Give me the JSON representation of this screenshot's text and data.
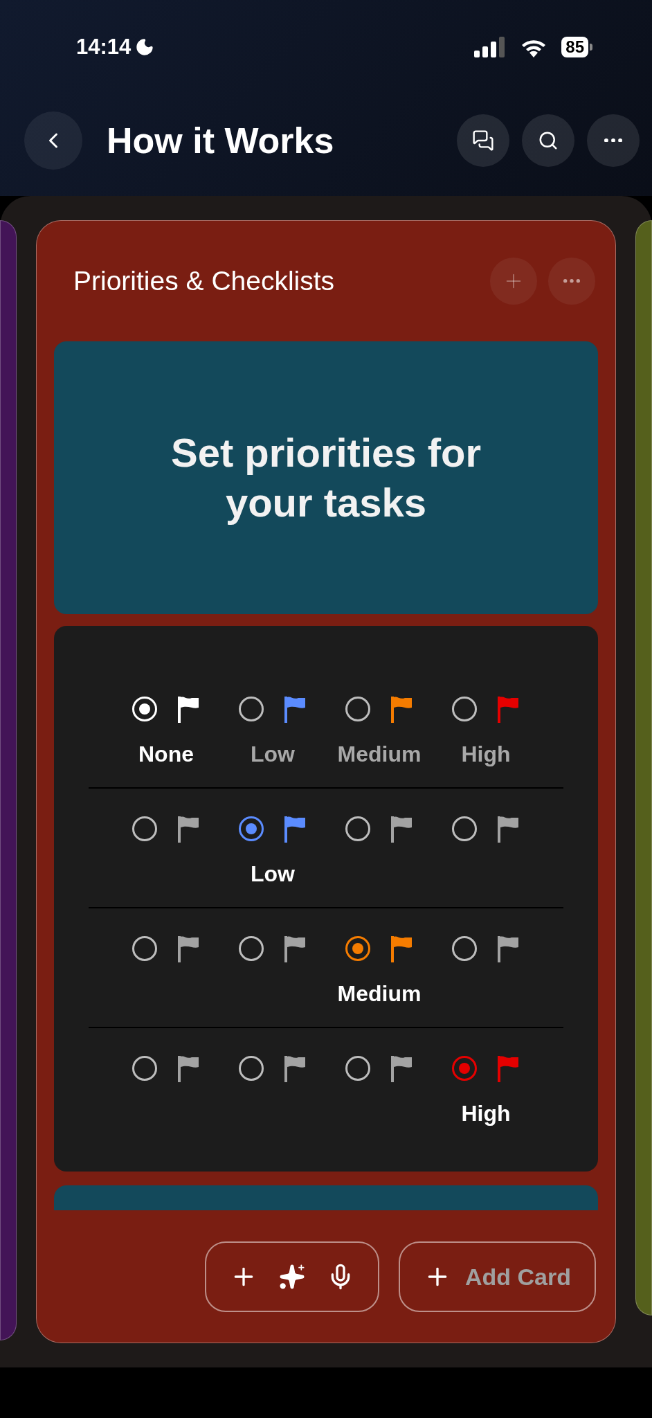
{
  "status_bar": {
    "time": "14:14",
    "battery": "85"
  },
  "header": {
    "title": "How it Works"
  },
  "column": {
    "title": "Priorities & Checklists",
    "cards": [
      {
        "kind": "text",
        "title": "Set priorities for your tasks"
      },
      {
        "kind": "priorities",
        "rows": [
          {
            "options": [
              {
                "label": "None",
                "selected": true,
                "color": "#ffffff"
              },
              {
                "label": "Low",
                "selected": false,
                "color": "#5b8cff"
              },
              {
                "label": "Medium",
                "selected": false,
                "color": "#f57c00"
              },
              {
                "label": "High",
                "selected": false,
                "color": "#e50000"
              }
            ]
          },
          {
            "options": [
              {
                "selected": false,
                "color": "#a3a3a3"
              },
              {
                "label": "Low",
                "selected": true,
                "color": "#5b8cff"
              },
              {
                "selected": false,
                "color": "#a3a3a3"
              },
              {
                "selected": false,
                "color": "#a3a3a3"
              }
            ]
          },
          {
            "options": [
              {
                "selected": false,
                "color": "#a3a3a3"
              },
              {
                "selected": false,
                "color": "#a3a3a3"
              },
              {
                "label": "Medium",
                "selected": true,
                "color": "#f57c00"
              },
              {
                "selected": false,
                "color": "#a3a3a3"
              }
            ]
          },
          {
            "options": [
              {
                "selected": false,
                "color": "#a3a3a3"
              },
              {
                "selected": false,
                "color": "#a3a3a3"
              },
              {
                "selected": false,
                "color": "#a3a3a3"
              },
              {
                "label": "High",
                "selected": true,
                "color": "#e50000"
              }
            ]
          }
        ]
      },
      {
        "kind": "peek"
      }
    ],
    "add_button": "Add Card"
  }
}
